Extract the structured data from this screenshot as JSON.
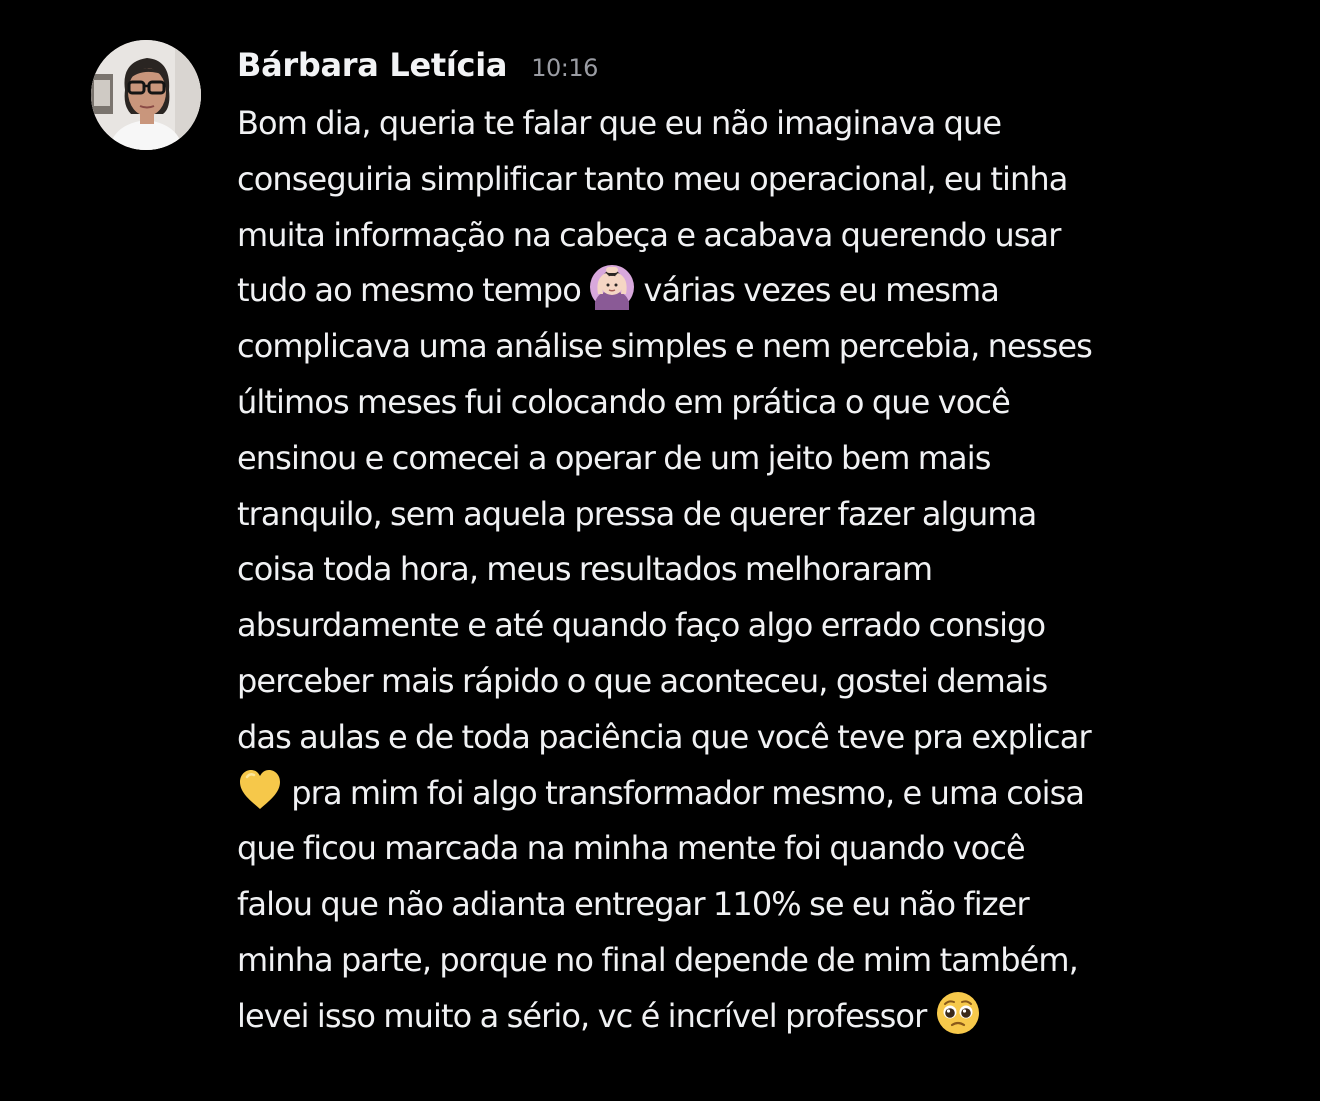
{
  "message": {
    "author": "Bárbara Letícia",
    "time": "10:16",
    "lines": [
      {
        "before": "Bom dia, queria te falar que eu não imaginava que"
      },
      {
        "before": "conseguiria simplificar tanto meu operacional, eu tinha"
      },
      {
        "before": "muita informação na cabeça e acabava querendo usar"
      },
      {
        "before": "tudo ao mesmo tempo ",
        "emoji": "woman-facepalm-emoji",
        "after": " várias vezes eu mesma"
      },
      {
        "before": "complicava uma análise simples e nem percebia, nesses"
      },
      {
        "before": "últimos meses fui colocando em prática o que você"
      },
      {
        "before": "ensinou e comecei a operar de um jeito bem mais"
      },
      {
        "before": "tranquilo, sem aquela pressa de querer fazer alguma"
      },
      {
        "before": "coisa toda hora, meus resultados melhoraram"
      },
      {
        "before": "absurdamente e até quando faço algo errado consigo"
      },
      {
        "before": "perceber mais rápido o que aconteceu, gostei demais"
      },
      {
        "before": "das aulas e de toda paciência que você teve pra explicar"
      },
      {
        "before": "",
        "emoji": "yellow-heart-emoji",
        "after": " pra mim foi algo transformador mesmo, e uma coisa"
      },
      {
        "before": "que ficou marcada na minha mente foi quando você"
      },
      {
        "before": "falou que não adianta entregar 110% se eu não fizer"
      },
      {
        "before": "minha parte, porque no final depende de mim também,"
      },
      {
        "before": "levei isso muito a sério, vc é incrível professor ",
        "emoji": "pleading-face-emoji",
        "after": ""
      }
    ]
  },
  "colors": {
    "background": "#000000",
    "text": "#f0f1f3",
    "timestamp": "#9a9ca3"
  }
}
